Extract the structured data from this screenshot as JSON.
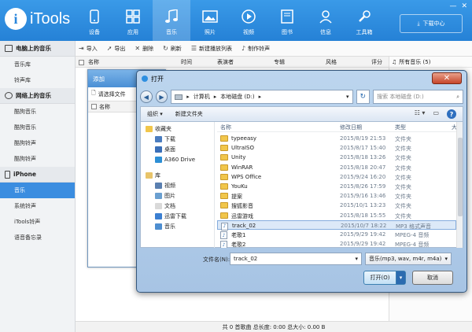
{
  "app": {
    "logo_text": "iTools",
    "nav": [
      {
        "label": "设备",
        "icon": "phone-icon"
      },
      {
        "label": "应用",
        "icon": "apps-icon"
      },
      {
        "label": "音乐",
        "icon": "music-note-icon",
        "active": true
      },
      {
        "label": "照片",
        "icon": "photo-icon"
      },
      {
        "label": "视频",
        "icon": "video-play-icon"
      },
      {
        "label": "图书",
        "icon": "book-icon"
      },
      {
        "label": "信息",
        "icon": "contacts-icon"
      },
      {
        "label": "工具箱",
        "icon": "wrench-icon"
      }
    ],
    "download_center": "下载中心",
    "accent_color": "#2e8fe0"
  },
  "sidebar": {
    "groups": [
      {
        "title": "电脑上的音乐",
        "items": [
          "音乐库",
          "铃声库"
        ]
      },
      {
        "title": "网络上的音乐",
        "items": [
          "酷狗音乐",
          "酷狗音乐",
          "酷狗铃声",
          "酷狗铃声"
        ]
      },
      {
        "title": "iPhone",
        "items": [
          "音乐",
          "系统铃声",
          "iTools铃声",
          "语音备忘录"
        ],
        "active_index": 0
      }
    ]
  },
  "toolbar": {
    "import": "导入",
    "export": "导出",
    "delete": "删除",
    "refresh": "刷新",
    "new_playlist": "新建播放列表",
    "make_ringtone": "制作铃声"
  },
  "table": {
    "columns": [
      "名称",
      "时间",
      "表演者",
      "专辑",
      "风格",
      "评分"
    ]
  },
  "playlists": {
    "all_music": "所有音乐 (5)"
  },
  "statusbar": {
    "text": "共 0 首歌曲    总长度: 0:00    总大小: 0.00 B"
  },
  "add_dialog": {
    "title": "添加",
    "choose_file": "请选择文件",
    "col_name": "名称"
  },
  "open_dialog": {
    "title": "打开",
    "path": [
      "计算机",
      "本地磁盘 (D:)"
    ],
    "search_placeholder": "搜索 本地磁盘 (D:)",
    "organize": "组织 ▾",
    "new_folder": "新建文件夹",
    "nav_items": [
      {
        "label": "收藏夹",
        "level": 1,
        "color": "#f1c64b"
      },
      {
        "label": "下载",
        "level": 2,
        "color": "#4a7cbf"
      },
      {
        "label": "桌面",
        "level": 2,
        "color": "#3a6fb8"
      },
      {
        "label": "A360 Drive",
        "level": 2,
        "color": "#2d8fd5"
      },
      {
        "label": "",
        "level": 0
      },
      {
        "label": "库",
        "level": 1,
        "color": "#e8c46a"
      },
      {
        "label": "视频",
        "level": 2,
        "color": "#5a7fb0"
      },
      {
        "label": "图片",
        "level": 2,
        "color": "#6a9fd0"
      },
      {
        "label": "文档",
        "level": 2,
        "color": "#d9d9d9"
      },
      {
        "label": "迅雷下载",
        "level": 2,
        "color": "#3b7fd1"
      },
      {
        "label": "音乐",
        "level": 2,
        "color": "#4e8ed0"
      }
    ],
    "file_columns": {
      "name": "名称",
      "date": "修改日期",
      "type": "类型",
      "size": "大"
    },
    "files": [
      {
        "name": "typeeasy",
        "date": "2015/8/19 21:53",
        "type": "文件夹",
        "kind": "folder"
      },
      {
        "name": "UltraISO",
        "date": "2015/8/17 15:40",
        "type": "文件夹",
        "kind": "folder"
      },
      {
        "name": "Unity",
        "date": "2015/8/18 13:26",
        "type": "文件夹",
        "kind": "folder"
      },
      {
        "name": "WinRAR",
        "date": "2015/8/18 20:47",
        "type": "文件夹",
        "kind": "folder"
      },
      {
        "name": "WPS Office",
        "date": "2015/9/24 16:20",
        "type": "文件夹",
        "kind": "folder"
      },
      {
        "name": "YouKu",
        "date": "2015/8/26 17:59",
        "type": "文件夹",
        "kind": "folder"
      },
      {
        "name": "提案",
        "date": "2015/9/16 13:46",
        "type": "文件夹",
        "kind": "folder"
      },
      {
        "name": "搜狐影音",
        "date": "2015/10/1 13:23",
        "type": "文件夹",
        "kind": "folder"
      },
      {
        "name": "迅雷游戏",
        "date": "2015/8/18 15:55",
        "type": "文件夹",
        "kind": "folder"
      },
      {
        "name": "track_02",
        "date": "2015/10/7 18:22",
        "type": "MP3 格式声音",
        "kind": "audio",
        "selected": true
      },
      {
        "name": "老歌1",
        "date": "2015/9/29 19:42",
        "type": "MPEG-4 音频",
        "kind": "audio"
      },
      {
        "name": "老歌2",
        "date": "2015/9/29 19:42",
        "type": "MPEG-4 音频",
        "kind": "audio"
      }
    ],
    "filename_label": "文件名(N):",
    "filename_value": "track_02",
    "filter_value": "音乐(mp3, wav, m4r, m4a)",
    "open_button": "打开(O)",
    "cancel_button": "取消"
  }
}
